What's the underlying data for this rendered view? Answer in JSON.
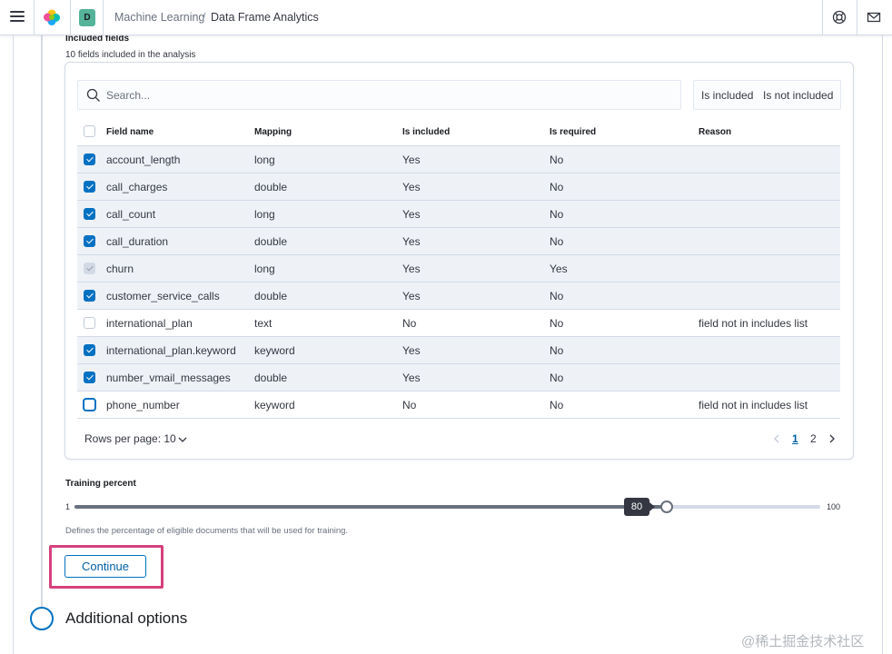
{
  "header": {
    "breadcrumbs": [
      "Machine Learning",
      "Data Frame Analytics"
    ],
    "separator": "/",
    "space_initial": "D"
  },
  "fields_section": {
    "title": "Included fields",
    "subtitle": "10 fields included in the analysis"
  },
  "search": {
    "placeholder": "Search..."
  },
  "filters": {
    "included": "Is included",
    "not_included": "Is not included"
  },
  "table": {
    "columns": [
      "Field name",
      "Mapping",
      "Is included",
      "Is required",
      "Reason"
    ],
    "rows": [
      {
        "name": "account_length",
        "mapping": "long",
        "included": "Yes",
        "required": "No",
        "reason": ""
      },
      {
        "name": "call_charges",
        "mapping": "double",
        "included": "Yes",
        "required": "No",
        "reason": ""
      },
      {
        "name": "call_count",
        "mapping": "long",
        "included": "Yes",
        "required": "No",
        "reason": ""
      },
      {
        "name": "call_duration",
        "mapping": "double",
        "included": "Yes",
        "required": "No",
        "reason": ""
      },
      {
        "name": "churn",
        "mapping": "long",
        "included": "Yes",
        "required": "Yes",
        "reason": ""
      },
      {
        "name": "customer_service_calls",
        "mapping": "double",
        "included": "Yes",
        "required": "No",
        "reason": ""
      },
      {
        "name": "international_plan",
        "mapping": "text",
        "included": "No",
        "required": "No",
        "reason": "field not in includes list"
      },
      {
        "name": "international_plan.keyword",
        "mapping": "keyword",
        "included": "Yes",
        "required": "No",
        "reason": ""
      },
      {
        "name": "number_vmail_messages",
        "mapping": "double",
        "included": "Yes",
        "required": "No",
        "reason": ""
      },
      {
        "name": "phone_number",
        "mapping": "keyword",
        "included": "No",
        "required": "No",
        "reason": "field not in includes list"
      }
    ]
  },
  "pagination": {
    "rows_per_page": "Rows per page: 10",
    "pages": [
      "1",
      "2"
    ],
    "current": "1"
  },
  "training": {
    "label": "Training percent",
    "min": "1",
    "max": "100",
    "value": "80",
    "helptext": "Defines the percentage of eligible documents that will be used for training."
  },
  "continue_label": "Continue",
  "next_step_title": "Additional options",
  "watermark": "@稀土掘金技术社区",
  "colors": {
    "primary": "#0071c2",
    "highlight": "#d6407d",
    "selected_row": "#eef2f7"
  }
}
